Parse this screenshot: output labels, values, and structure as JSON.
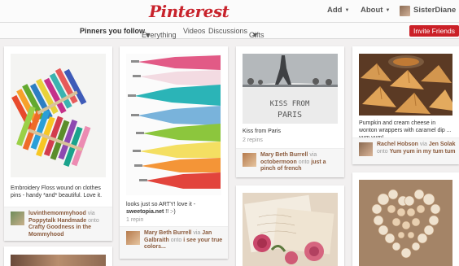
{
  "header": {
    "logo": "Pinterest",
    "add_label": "Add",
    "about_label": "About",
    "user_name": "SisterDiane"
  },
  "subnav": {
    "items": [
      "Pinners you follow",
      "Everything",
      "Videos",
      "Discussions",
      "Gifts"
    ],
    "invite_label": "Invite Friends"
  },
  "pins": [
    {
      "description": "Embroidery Floss wound on clothes pins - handy *and* beautiful. Love it.",
      "pinner": "luvinthemommyhood",
      "via_word": "via",
      "via_user": "Poppytalk Handmade",
      "onto_word": "onto",
      "board": "Crafty Goodness in the Mommyhood"
    },
    {
      "description": "looks just so ARTY! love it -",
      "source": "sweetopia.net",
      "source_suffix": "!! :-)",
      "repins": "1 repin",
      "pinner": "Mary Beth Burrell",
      "via_word": "via",
      "via_user": "Jan Galbraith",
      "onto_word": "onto",
      "board": "i see your true colors..."
    },
    {
      "description": "Kiss from Paris",
      "repins": "2 repins",
      "pinner": "Mary Beth Burrell",
      "via_word": "via",
      "via_user": "octobermoon",
      "onto_word": "onto",
      "board": "just a pinch of french",
      "image_text_1": "KISS FROM",
      "image_text_2": "PARIS"
    },
    {
      "description": "Pumpkin and cream cheese in wonton wrappers with caramel dip ... yum yum!",
      "pinner": "Rachel Hobson",
      "via_word": "via",
      "via_user": "Jen Solak",
      "onto_word": "onto",
      "board": "Yum yum in my tum tum"
    }
  ]
}
